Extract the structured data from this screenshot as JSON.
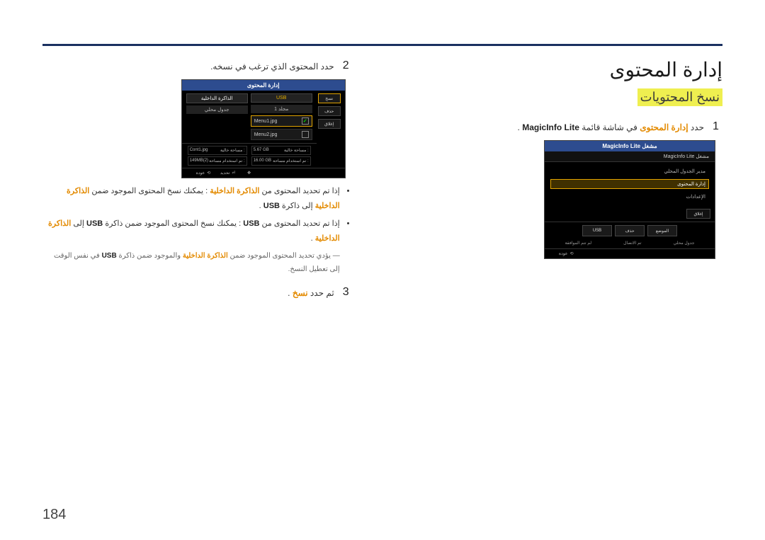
{
  "page_number": "184",
  "h1": "إدارة المحتوى",
  "h2": "نسخ المحتويات",
  "step1": {
    "num": "1",
    "text_prefix": "حدد ",
    "text_accent": "إدارة المحتوى",
    "text_mid": " في شاشة قائمة ",
    "text_bold": "MagicInfo Lite",
    "text_suffix": "."
  },
  "panel1": {
    "title": "مشغل MagicInfo Lite",
    "sub": "مشغل MagicInfo Lite",
    "item1": "مدير الجدول المحلي",
    "item2_sel": "إدارة المحتوى",
    "item3": "الإعدادات",
    "side_btn": "إغلاق",
    "btn1": "الموضع",
    "btn2": "حذف",
    "btn3": "USB",
    "lbl1": "جدول محلي",
    "lbl2": "تم الاتصال",
    "lbl3": "لم تتم الموافقة",
    "foot_back": "عودة"
  },
  "step2": {
    "num": "2",
    "text": "حدد المحتوى الذي ترغب في نسخه."
  },
  "panel2": {
    "title": "إدارة المحتوى",
    "colL_hdr": "الذاكرة الداخلية",
    "colR_hdr": "USB",
    "colL_sub": "جدول محلي",
    "colR_sub": "مجلد 1",
    "file1": "Menu1.jpg",
    "file2": "Menu2.jpg",
    "side": {
      "copy": "نسخ",
      "del": "حذف",
      "close": "إغلاق"
    },
    "meta": {
      "free_lbl": "مساحة خالية :",
      "free_val": "5.67 GB",
      "used_lbl": "تم استخدام مساحة :",
      "used_val": "16.00 GB",
      "free2_lbl": "مساحة خالية :",
      "free2_val": "Cont1.jpg",
      "used2_lbl": "تم استخدام مساحة :",
      "used2_val": "149MB(2)"
    },
    "foot": {
      "select": "تحديد",
      "back": "عودة",
      "enter": "تحديد"
    }
  },
  "bullets": {
    "b1": {
      "t1": "إذا تم تحديد المحتوى من ",
      "a1": "الذاكرة الداخلية",
      "t2": ": يمكنك نسخ المحتوى الموجود ضمن ",
      "a2": "الذاكرة الداخلية",
      "t3": " إلى ذاكرة ",
      "b": "USB",
      "t4": "."
    },
    "b2": {
      "t1": "إذا تم تحديد المحتوى من ",
      "b1": "USB",
      "t2": ": يمكنك نسخ المحتوى الموجود ضمن ذاكرة ",
      "b2": "USB",
      "t3": " إلى ",
      "a": "الذاكرة الداخلية",
      "t4": "."
    },
    "note": {
      "t0": "―",
      "t1": "يؤدي تحديد المحتوى الموجود ضمن ",
      "a": "الذاكرة الداخلية",
      "t2": " والموجود ضمن ذاكرة ",
      "b": "USB",
      "t3": " في نفس الوقت إلى تعطيل النسخ."
    }
  },
  "step3": {
    "num": "3",
    "text_prefix": "ثم حدد ",
    "text_accent": "نسخ",
    "text_suffix": "."
  }
}
